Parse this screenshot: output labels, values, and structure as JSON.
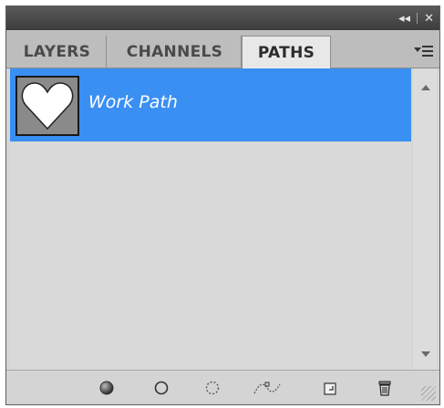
{
  "panel": {
    "title_controls": {
      "collapse_glyph": "◂◂",
      "close_glyph": "✕"
    },
    "tabs": [
      {
        "label": "LAYERS"
      },
      {
        "label": "CHANNELS"
      },
      {
        "label": "PATHS"
      }
    ],
    "active_tab": "PATHS",
    "menu_icon": "panel-menu-icon",
    "paths": [
      {
        "label": "Work Path",
        "thumbnail": "heart-shape",
        "selected": true
      }
    ],
    "bottom_buttons": [
      {
        "name": "fill-path-icon"
      },
      {
        "name": "stroke-path-icon"
      },
      {
        "name": "load-path-as-selection-icon"
      },
      {
        "name": "make-work-path-icon"
      },
      {
        "name": "new-path-icon"
      },
      {
        "name": "delete-path-icon"
      }
    ],
    "colors": {
      "selection": "#3a8ff3",
      "panel_bg": "#d6d6d6",
      "titlebar": "#4a4a4a"
    }
  }
}
